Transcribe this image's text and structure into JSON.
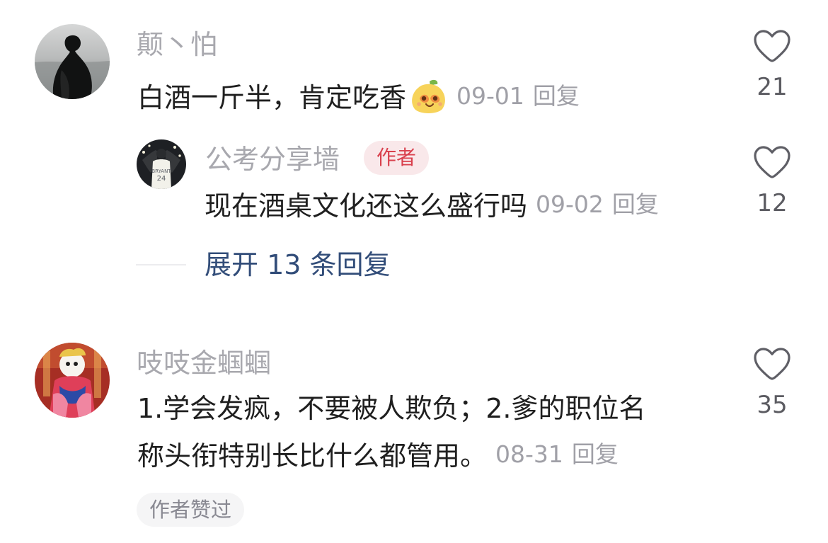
{
  "comments": [
    {
      "username": "颠丶怕",
      "text": "白酒一斤半，肯定吃香",
      "emoji": "smiling-bun-emoji",
      "date": "09-01",
      "reply_label": "回复",
      "like_count": "21",
      "like_icon": "heart-outline-icon",
      "reply": {
        "username": "公考分享墙",
        "badge": "作者",
        "text": "现在酒桌文化还这么盛行吗",
        "date": "09-02",
        "reply_label": "回复",
        "like_count": "12",
        "like_icon": "heart-outline-icon"
      },
      "expand_replies_label": "展开 13 条回复"
    },
    {
      "username": "吱吱金蝈蝈",
      "text_line1": "1.学会发疯，不要被人欺负；2.爹的职位名",
      "text_line2": "称头衔特别长比什么都管用。",
      "date": "08-31",
      "reply_label": "回复",
      "like_count": "35",
      "like_icon": "heart-outline-icon",
      "author_liked_label": "作者赞过"
    }
  ],
  "colors": {
    "background": "#ffffff",
    "username": "#a8a8ae",
    "comment_text": "#1f1f1f",
    "meta": "#a0a0a7",
    "author_badge_bg": "#f9e8ea",
    "author_badge_text": "#d9404d",
    "expand_link": "#324d79",
    "pill_bg": "#f5f5f6",
    "pill_text": "#888891"
  }
}
